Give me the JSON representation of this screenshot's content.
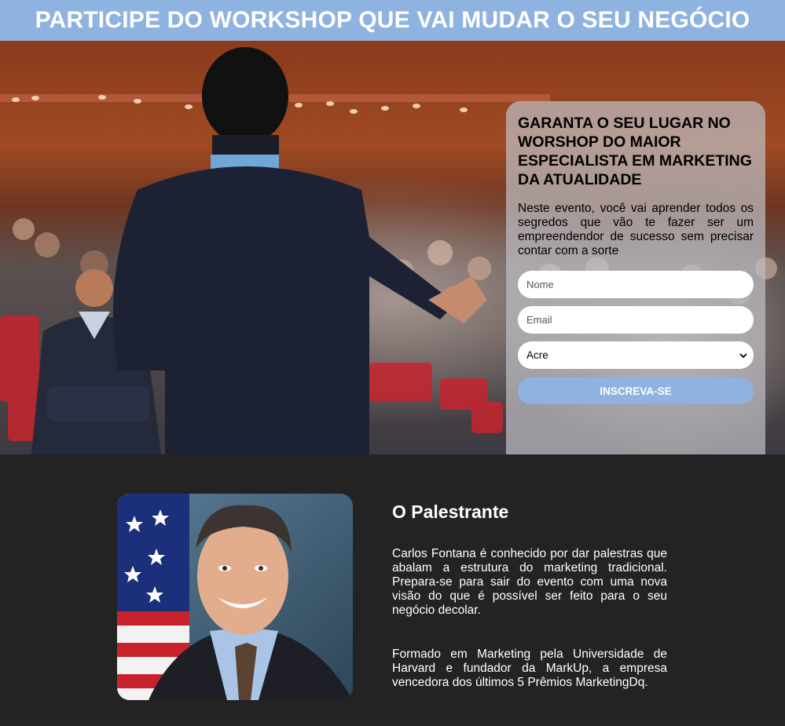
{
  "header": {
    "title": "PARTICIPE DO WORKSHOP QUE VAI MUDAR O SEU NEGÓCIO"
  },
  "form": {
    "heading": "GARANTA O SEU LUGAR NO WORSHOP DO MAIOR ESPECIALISTA EM MARKETING DA ATUALIDADE",
    "description": "Neste evento, você vai aprender todos os segredos que vão te fazer ser um empreendendor de sucesso sem precisar contar com a sorte",
    "name_placeholder": "Nome",
    "email_placeholder": "Email",
    "state_selected": "Acre",
    "submit_label": "INSCREVA-SE"
  },
  "speaker": {
    "heading": "O Palestrante",
    "paragraph1": "Carlos Fontana é conhecido por dar palestras que abalam a estrutura do marketing tradicional. Prepara-se para sair do evento com uma nova visão do que é possível ser feito para o seu negócio decolar.",
    "paragraph2": "Formado em Marketing pela Universidade de Harvard e fundador da MarkUp, a empresa vencedora dos últimos 5 Prêmios MarketingDq."
  },
  "colors": {
    "accent": "#8fb3e0",
    "dark_bg": "#232323"
  },
  "icons": {
    "select_arrow": "chevron-down-icon"
  }
}
